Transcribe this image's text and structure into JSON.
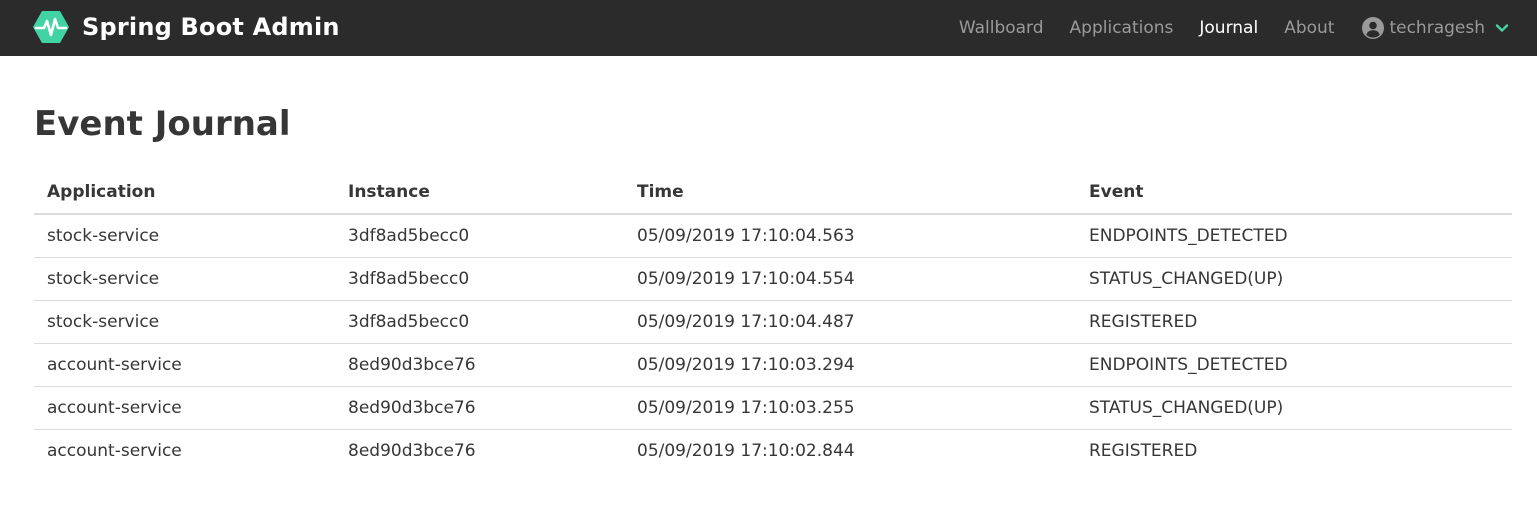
{
  "navbar": {
    "brand": "Spring Boot Admin",
    "brand_color": "#42d3a5",
    "logo_icon": "heartbeat-hexagon-icon",
    "links": [
      {
        "label": "Wallboard",
        "active": false
      },
      {
        "label": "Applications",
        "active": false
      },
      {
        "label": "Journal",
        "active": true
      },
      {
        "label": "About",
        "active": false
      }
    ],
    "user": {
      "name": "techragesh",
      "icon": "user-circle-icon",
      "dropdown_icon": "chevron-down-icon"
    }
  },
  "main": {
    "title": "Event Journal",
    "table": {
      "headers": {
        "application": "Application",
        "instance": "Instance",
        "time": "Time",
        "event": "Event"
      },
      "rows": [
        {
          "application": "stock-service",
          "instance": "3df8ad5becc0",
          "time": "05/09/2019 17:10:04.563",
          "event": "ENDPOINTS_DETECTED"
        },
        {
          "application": "stock-service",
          "instance": "3df8ad5becc0",
          "time": "05/09/2019 17:10:04.554",
          "event": "STATUS_CHANGED(UP)"
        },
        {
          "application": "stock-service",
          "instance": "3df8ad5becc0",
          "time": "05/09/2019 17:10:04.487",
          "event": "REGISTERED"
        },
        {
          "application": "account-service",
          "instance": "8ed90d3bce76",
          "time": "05/09/2019 17:10:03.294",
          "event": "ENDPOINTS_DETECTED"
        },
        {
          "application": "account-service",
          "instance": "8ed90d3bce76",
          "time": "05/09/2019 17:10:03.255",
          "event": "STATUS_CHANGED(UP)"
        },
        {
          "application": "account-service",
          "instance": "8ed90d3bce76",
          "time": "05/09/2019 17:10:02.844",
          "event": "REGISTERED"
        }
      ]
    }
  }
}
